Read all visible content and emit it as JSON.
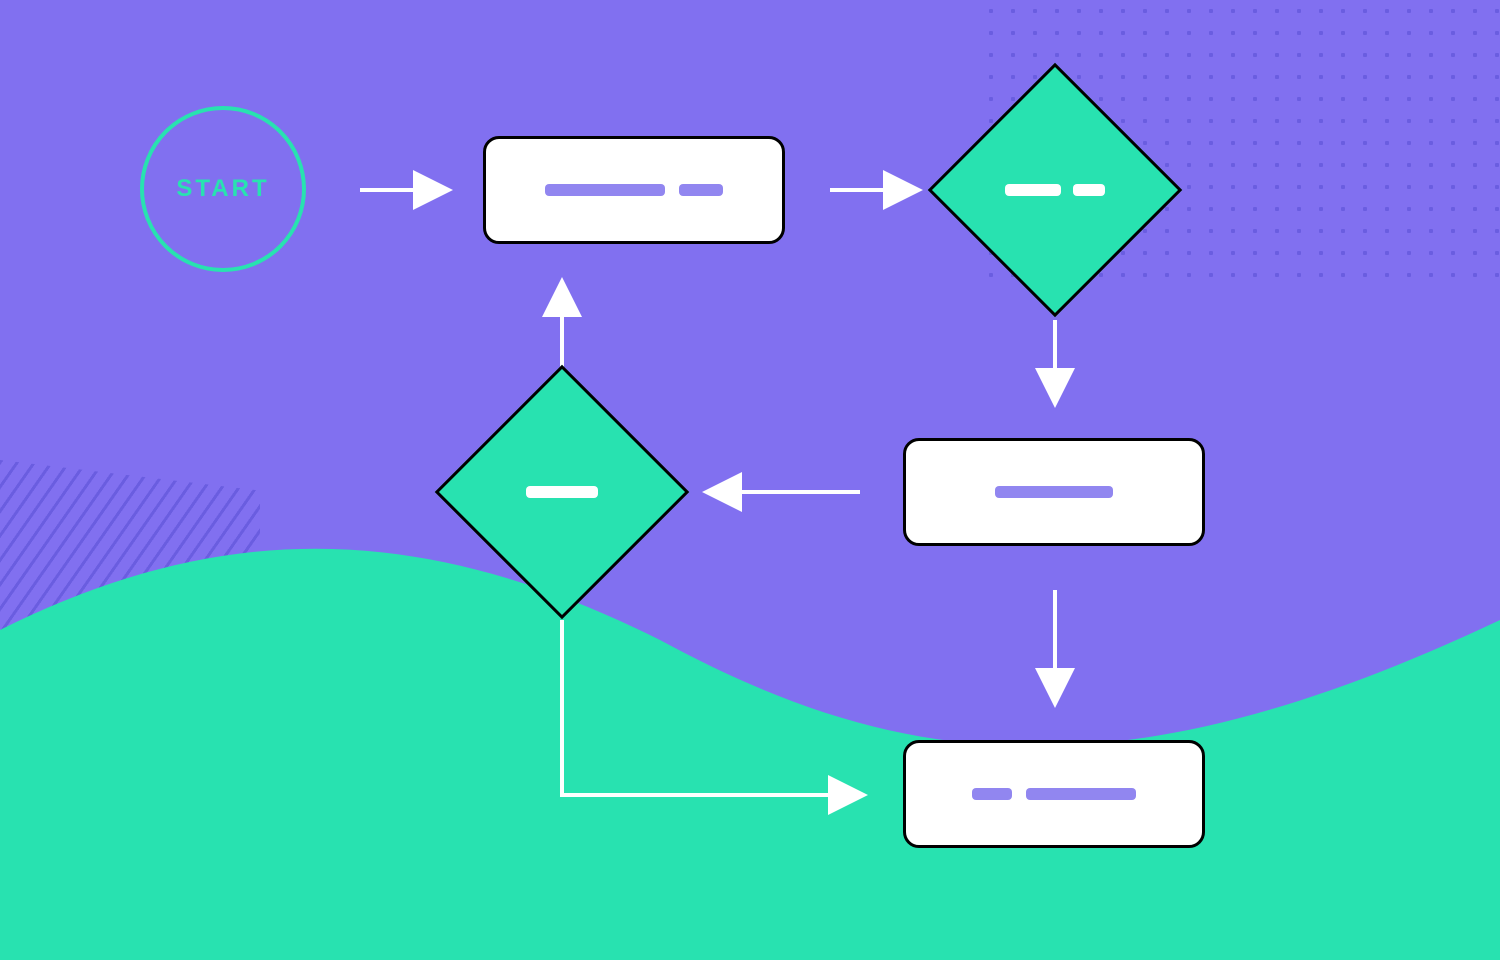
{
  "colors": {
    "background": "#8170F0",
    "accent": "#28E2B0",
    "node_fill": "#FFFFFF",
    "node_border": "#000000",
    "placeholder_bar": "#9186F0",
    "arrow": "#FFFFFF"
  },
  "nodes": {
    "start": {
      "type": "terminator",
      "label": "START"
    },
    "process_top": {
      "type": "process",
      "placeholder_bars": 2
    },
    "decision_top_right": {
      "type": "decision",
      "placeholder_bars": 2
    },
    "process_mid_right": {
      "type": "process",
      "placeholder_bars": 1
    },
    "decision_mid_left": {
      "type": "decision",
      "placeholder_bars": 1
    },
    "process_bottom_right": {
      "type": "process",
      "placeholder_bars": 2
    }
  },
  "edges": [
    {
      "from": "start",
      "to": "process_top",
      "direction": "right"
    },
    {
      "from": "process_top",
      "to": "decision_top_right",
      "direction": "right"
    },
    {
      "from": "decision_top_right",
      "to": "process_mid_right",
      "direction": "down"
    },
    {
      "from": "process_mid_right",
      "to": "decision_mid_left",
      "direction": "left"
    },
    {
      "from": "decision_mid_left",
      "to": "process_top",
      "direction": "up"
    },
    {
      "from": "process_mid_right",
      "to": "process_bottom_right",
      "direction": "down"
    },
    {
      "from": "decision_mid_left",
      "to": "process_bottom_right",
      "direction": "down-then-right"
    }
  ]
}
